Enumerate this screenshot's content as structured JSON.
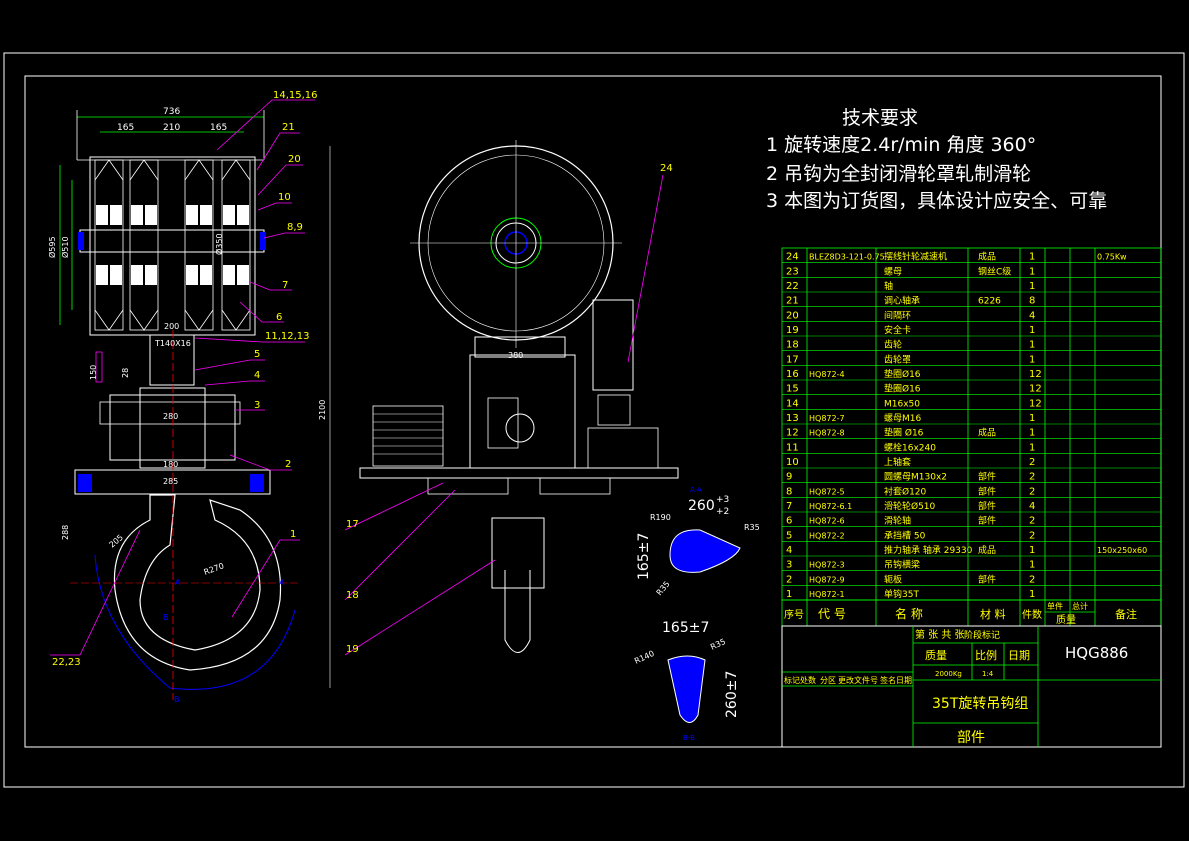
{
  "tech_requirements": {
    "title": "技术要求",
    "lines": [
      "1  旋转速度2.4r/min   角度  360°",
      "2  吊钩为全封闭滑轮罩轧制滑轮",
      "3  本图为订货图，具体设计应安全、可靠"
    ]
  },
  "colors": {
    "background": "#000000",
    "frame": "#ffffff",
    "outline": "#ffffff",
    "dimension": "#00ff00",
    "leader": "#ff00ff",
    "table_line": "#00ff00",
    "table_text": "#ffff00",
    "centerline": "#ff0000",
    "hatch": "#0000ff",
    "part_fill": "#0000ff"
  },
  "dimensions_left": {
    "overall_width": "736",
    "spacing_1": "165",
    "spacing_2": "210",
    "spacing_3": "165",
    "dia_outer": "Ø595",
    "dia_inner": "Ø510",
    "dia_right": "Ø350",
    "thread": "T140X16",
    "width_200": "200",
    "height_150": "150",
    "height_28": "28",
    "width_280": "280",
    "width_180": "180",
    "width_285": "285",
    "hook_288": "288",
    "hook_205": "205",
    "hook_r270": "R270",
    "hook_a1": "A",
    "hook_a2": "A",
    "hook_b": "B",
    "hook_b2": "B"
  },
  "labels_left": [
    "14,15,16",
    "21",
    "20",
    "10",
    "8,9",
    "7",
    "6",
    "11,12,13",
    "5",
    "4",
    "3",
    "2",
    "1",
    "22,23"
  ],
  "dimensions_middle": {
    "height": "2100",
    "width_380": "380"
  },
  "labels_middle": [
    "24",
    "17",
    "18",
    "19"
  ],
  "section_aa": {
    "title": "A-A",
    "width": "260",
    "tol_up": "+3",
    "tol_dn": "+2",
    "r190": "R190",
    "r35": "R35",
    "height": "165±7",
    "r35b": "R35"
  },
  "section_bb": {
    "title": "B-B",
    "width": "165±7",
    "r140": "R140",
    "r35": "R35",
    "height": "260±7"
  },
  "parts_table": [
    {
      "no": "24",
      "code": "BLEZ8D3-121-0.75",
      "name": "摆线针轮减速机",
      "mat": "成品",
      "qty": "1",
      "note": "0.75Kw"
    },
    {
      "no": "23",
      "code": "",
      "name": "螺母",
      "mat": "钢丝C级",
      "qty": "1",
      "note": ""
    },
    {
      "no": "22",
      "code": "",
      "name": "轴",
      "mat": "",
      "qty": "1",
      "note": ""
    },
    {
      "no": "21",
      "code": "",
      "name": "调心轴承",
      "mat": "6226",
      "qty": "8",
      "note": ""
    },
    {
      "no": "20",
      "code": "",
      "name": "间隔环",
      "mat": "",
      "qty": "4",
      "note": ""
    },
    {
      "no": "19",
      "code": "",
      "name": "安全卡",
      "mat": "",
      "qty": "1",
      "note": ""
    },
    {
      "no": "18",
      "code": "",
      "name": "齿轮",
      "mat": "",
      "qty": "1",
      "note": ""
    },
    {
      "no": "17",
      "code": "",
      "name": "齿轮罩",
      "mat": "",
      "qty": "1",
      "note": ""
    },
    {
      "no": "16",
      "code": "HQ872-4",
      "name": "垫圈Ø16",
      "mat": "",
      "qty": "12",
      "note": ""
    },
    {
      "no": "15",
      "code": "",
      "name": "垫圈Ø16",
      "mat": "",
      "qty": "12",
      "note": ""
    },
    {
      "no": "14",
      "code": "",
      "name": "M16x50",
      "mat": "",
      "qty": "12",
      "note": ""
    },
    {
      "no": "13",
      "code": "HQ872-7",
      "name": "螺母M16",
      "mat": "",
      "qty": "1",
      "note": ""
    },
    {
      "no": "12",
      "code": "HQ872-8",
      "name": "垫圈 Ø16",
      "mat": "成品",
      "qty": "1",
      "note": ""
    },
    {
      "no": "11",
      "code": "",
      "name": "螺栓16x240",
      "mat": "",
      "qty": "1",
      "note": ""
    },
    {
      "no": "10",
      "code": "",
      "name": "上轴套",
      "mat": "",
      "qty": "2",
      "note": ""
    },
    {
      "no": "9",
      "code": "",
      "name": "圆螺母M130x2",
      "mat": "部件",
      "qty": "2",
      "note": ""
    },
    {
      "no": "8",
      "code": "HQ872-5",
      "name": "衬套Ø120",
      "mat": "部件",
      "qty": "2",
      "note": ""
    },
    {
      "no": "7",
      "code": "HQ872-6.1",
      "name": "滑轮轮Ø510",
      "mat": "部件",
      "qty": "4",
      "note": ""
    },
    {
      "no": "6",
      "code": "HQ872-6",
      "name": "滑轮轴",
      "mat": "部件",
      "qty": "2",
      "note": ""
    },
    {
      "no": "5",
      "code": "HQ872-2",
      "name": "承挡槽 50",
      "mat": "",
      "qty": "2",
      "note": ""
    },
    {
      "no": "4",
      "code": "",
      "name": "推力轴承 轴承 29330",
      "mat": "成品",
      "qty": "1",
      "note": "150x250x60"
    },
    {
      "no": "3",
      "code": "HQ872-3",
      "name": "吊钩横梁",
      "mat": "",
      "qty": "1",
      "note": ""
    },
    {
      "no": "2",
      "code": "HQ872-9",
      "name": "轭板",
      "mat": "部件",
      "qty": "2",
      "note": ""
    },
    {
      "no": "1",
      "code": "HQ872-1",
      "name": "单钩35T",
      "mat": "",
      "qty": "1",
      "note": ""
    }
  ],
  "table_header": {
    "no": "序号",
    "code": "代  号",
    "name": "名  称",
    "mat": "材 料",
    "qty": "件数",
    "unit": "单件",
    "total": "总计",
    "weight": "质量",
    "note": "备注"
  },
  "title_block": {
    "sheet": "第 张 共 张",
    "stage": "阶段标记",
    "mass_label": "质量",
    "scale_label": "比例",
    "date_label": "日期",
    "mass_value": "2000Kg",
    "scale_value": "1:4",
    "drawing_no": "HQG886",
    "title": "35T旋转吊钩组",
    "type": "部件",
    "left_1": "标记",
    "left_2": "处数",
    "left_3": "分区",
    "left_4": "更改文件号",
    "left_5": "签名",
    "left_6": "日期"
  }
}
